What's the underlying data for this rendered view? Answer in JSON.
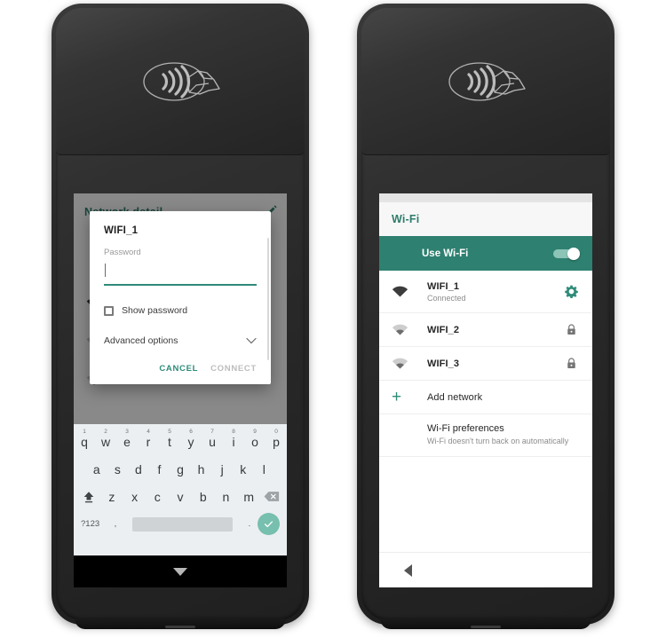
{
  "colors": {
    "teal": "#2e8b79",
    "teal_bar": "#2e8070",
    "teal_header_text": "#2e7d6b",
    "disabled_gray": "#bdbdbd",
    "keyboard_bg": "#eceff1",
    "enter_green": "#77bfae"
  },
  "left_device": {
    "name": "payment-terminal-left",
    "nfc_icon": "contactless-payment-icon",
    "background_screen": {
      "title": "Network detail",
      "edit_icon": "pencil-edit-icon"
    },
    "dialog": {
      "title": "WIFI_1",
      "password_label": "Password",
      "password_value": "",
      "show_password_label": "Show password",
      "show_password_checked": false,
      "advanced_options_label": "Advanced options",
      "advanced_chevron": "chevron-down-icon",
      "cancel_label": "CANCEL",
      "connect_label": "CONNECT",
      "connect_enabled": false
    },
    "keyboard": {
      "row1": [
        {
          "key": "q",
          "num": "1"
        },
        {
          "key": "w",
          "num": "2"
        },
        {
          "key": "e",
          "num": "3"
        },
        {
          "key": "r",
          "num": "4"
        },
        {
          "key": "t",
          "num": "5"
        },
        {
          "key": "y",
          "num": "6"
        },
        {
          "key": "u",
          "num": "7"
        },
        {
          "key": "i",
          "num": "8"
        },
        {
          "key": "o",
          "num": "9"
        },
        {
          "key": "p",
          "num": "0"
        }
      ],
      "row2": [
        "a",
        "s",
        "d",
        "f",
        "g",
        "h",
        "j",
        "k",
        "l"
      ],
      "row3": [
        "z",
        "x",
        "c",
        "v",
        "b",
        "n",
        "m"
      ],
      "shift_icon": "shift-up-arrow-icon",
      "backspace_icon": "backspace-delete-icon",
      "symbols_label": "?123",
      "comma_label": ",",
      "period_label": ".",
      "space_label": "",
      "enter_icon": "checkmark-enter-icon"
    },
    "navbar": {
      "down_icon": "hide-keyboard-down-icon"
    }
  },
  "right_device": {
    "name": "payment-terminal-right",
    "nfc_icon": "contactless-payment-icon",
    "wifi_screen": {
      "header_title": "Wi-Fi",
      "use_wifi_label": "Use Wi-Fi",
      "use_wifi_on": true,
      "networks": [
        {
          "ssid": "WIFI_1",
          "status": "Connected",
          "signal": "full",
          "trailing_icon": "gear-settings-icon",
          "trailing_color": "#2e8b79"
        },
        {
          "ssid": "WIFI_2",
          "status": "",
          "signal": "weak",
          "trailing_icon": "lock-icon",
          "trailing_color": "#757575"
        },
        {
          "ssid": "WIFI_3",
          "status": "",
          "signal": "weak",
          "trailing_icon": "lock-icon",
          "trailing_color": "#757575"
        }
      ],
      "add_network_label": "Add network",
      "add_network_icon": "plus-icon",
      "preferences_title": "Wi-Fi preferences",
      "preferences_subtitle": "Wi-Fi doesn't turn back on automatically"
    },
    "navbar": {
      "back_icon": "back-triangle-icon"
    }
  }
}
